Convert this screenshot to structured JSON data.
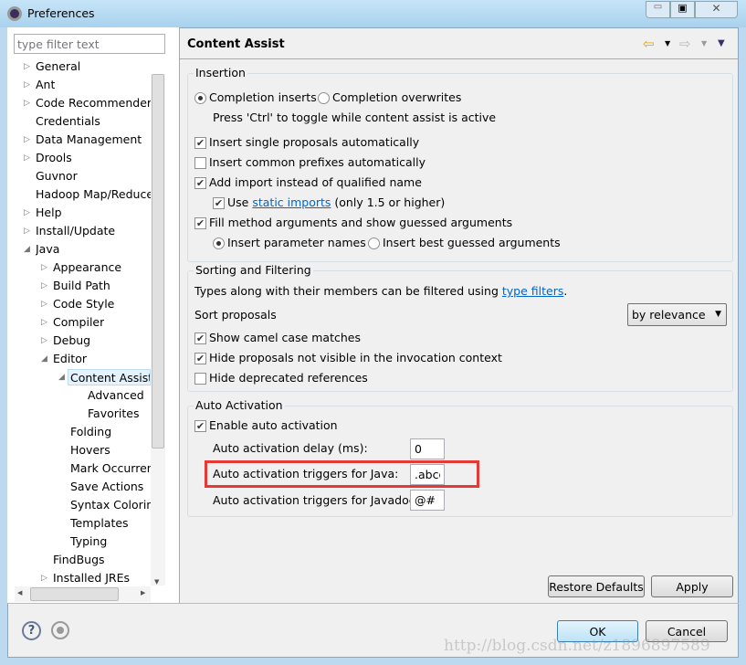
{
  "window": {
    "title": "Preferences"
  },
  "filter": {
    "placeholder": "type filter text"
  },
  "tree": [
    {
      "label": "General",
      "level": 0,
      "arrow": "▷"
    },
    {
      "label": "Ant",
      "level": 0,
      "arrow": "▷"
    },
    {
      "label": "Code Recommenders",
      "level": 0,
      "arrow": "▷"
    },
    {
      "label": "Credentials",
      "level": 0,
      "arrow": ""
    },
    {
      "label": "Data Management",
      "level": 0,
      "arrow": "▷"
    },
    {
      "label": "Drools",
      "level": 0,
      "arrow": "▷"
    },
    {
      "label": "Guvnor",
      "level": 0,
      "arrow": ""
    },
    {
      "label": "Hadoop Map/Reduce",
      "level": 0,
      "arrow": ""
    },
    {
      "label": "Help",
      "level": 0,
      "arrow": "▷"
    },
    {
      "label": "Install/Update",
      "level": 0,
      "arrow": "▷"
    },
    {
      "label": "Java",
      "level": 0,
      "arrow": "◢"
    },
    {
      "label": "Appearance",
      "level": 1,
      "arrow": "▷"
    },
    {
      "label": "Build Path",
      "level": 1,
      "arrow": "▷"
    },
    {
      "label": "Code Style",
      "level": 1,
      "arrow": "▷"
    },
    {
      "label": "Compiler",
      "level": 1,
      "arrow": "▷"
    },
    {
      "label": "Debug",
      "level": 1,
      "arrow": "▷"
    },
    {
      "label": "Editor",
      "level": 1,
      "arrow": "◢"
    },
    {
      "label": "Content Assist",
      "level": 2,
      "arrow": "◢",
      "selected": true
    },
    {
      "label": "Advanced",
      "level": 3,
      "arrow": ""
    },
    {
      "label": "Favorites",
      "level": 3,
      "arrow": ""
    },
    {
      "label": "Folding",
      "level": 2,
      "arrow": ""
    },
    {
      "label": "Hovers",
      "level": 2,
      "arrow": ""
    },
    {
      "label": "Mark Occurrences",
      "level": 2,
      "arrow": ""
    },
    {
      "label": "Save Actions",
      "level": 2,
      "arrow": ""
    },
    {
      "label": "Syntax Coloring",
      "level": 2,
      "arrow": ""
    },
    {
      "label": "Templates",
      "level": 2,
      "arrow": ""
    },
    {
      "label": "Typing",
      "level": 2,
      "arrow": ""
    },
    {
      "label": "FindBugs",
      "level": 1,
      "arrow": ""
    },
    {
      "label": "Installed JREs",
      "level": 1,
      "arrow": "▷"
    }
  ],
  "page": {
    "title": "Content Assist"
  },
  "insertion": {
    "title": "Insertion",
    "completion_inserts": "Completion inserts",
    "completion_overwrites": "Completion overwrites",
    "toggle_hint": "Press 'Ctrl' to toggle while content assist is active",
    "insert_single": "Insert single proposals automatically",
    "insert_common": "Insert common prefixes automatically",
    "add_import": "Add import instead of qualified name",
    "use": "Use",
    "static_imports": "static imports",
    "only15": "(only 1.5 or higher)",
    "fill_args": "Fill method arguments and show guessed arguments",
    "insert_param_names": "Insert parameter names",
    "insert_best_guessed": "Insert best guessed arguments"
  },
  "sorting": {
    "title": "Sorting and Filtering",
    "desc": "Types along with their members can be filtered using",
    "type_filters": "type filters",
    "period": ".",
    "sort_label": "Sort proposals",
    "sort_value": "by relevance",
    "camel": "Show camel case matches",
    "hide_not_visible": "Hide proposals not visible in the invocation context",
    "hide_deprecated": "Hide deprecated references"
  },
  "auto": {
    "title": "Auto Activation",
    "enable": "Enable auto activation",
    "delay_label": "Auto activation delay (ms):",
    "delay_value": "0",
    "java_label": "Auto activation triggers for Java:",
    "java_value": ".abcd",
    "javadoc_label": "Auto activation triggers for Javadoc:",
    "javadoc_value": "@#"
  },
  "buttons": {
    "restore": "Restore Defaults",
    "apply": "Apply",
    "ok": "OK",
    "cancel": "Cancel"
  },
  "watermark": "http://blog.csdn.net/z1896897589",
  "colors": {
    "highlight": "#e53935",
    "link": "#0066cc"
  }
}
